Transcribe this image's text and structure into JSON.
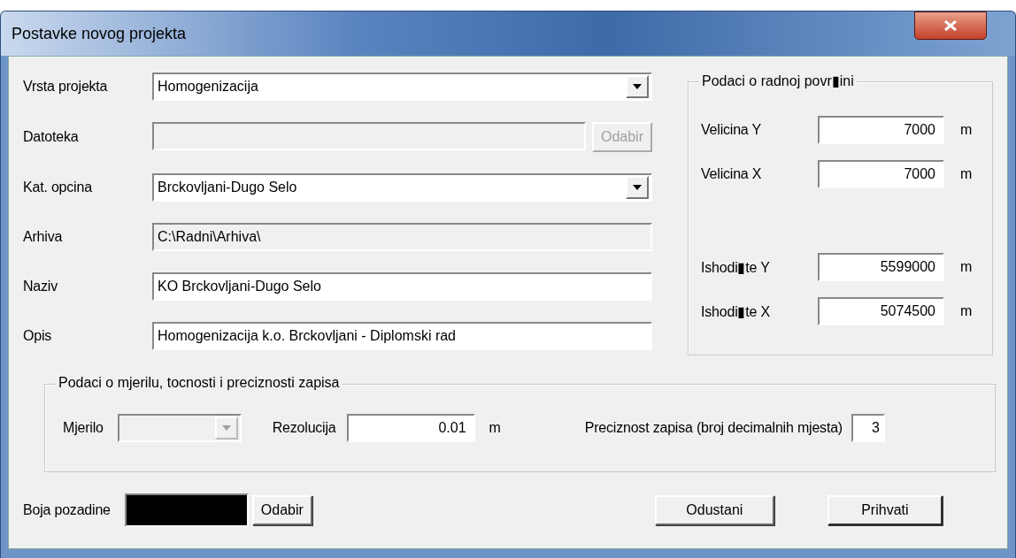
{
  "window": {
    "title": "Postavke novog projekta"
  },
  "fields": [
    {
      "label": "Vrsta projekta",
      "kind": "combo",
      "value": "Homogenizacija",
      "disabled": false
    },
    {
      "label": "Datoteka",
      "kind": "file",
      "button": "Odabir",
      "disabled": true
    },
    {
      "label": "Kat. opcina",
      "kind": "combo",
      "value": "Brckovljani-Dugo Selo",
      "disabled": false
    },
    {
      "label": "Arhiva",
      "kind": "text",
      "value": "C:\\Radni\\Arhiva\\",
      "disabled": true
    },
    {
      "label": "Naziv",
      "kind": "text",
      "value": "KO Brckovljani-Dugo Selo",
      "disabled": false
    },
    {
      "label": "Opis",
      "kind": "text",
      "value": "Homogenizacija k.o. Brckovljani - Diplomski rad",
      "disabled": false
    }
  ],
  "work_area": {
    "title": "Podaci o radnoj povr▮ini",
    "size_fields": [
      {
        "label": "Velicina Y",
        "value": "7000",
        "unit": "m"
      },
      {
        "label": "Velicina X",
        "value": "7000",
        "unit": "m"
      }
    ],
    "origin_fields": [
      {
        "label": "Ishodi▮te Y",
        "value": "5599000",
        "unit": "m"
      },
      {
        "label": "Ishodi▮te X",
        "value": "5074500",
        "unit": "m"
      }
    ]
  },
  "scale_group": {
    "title": "Podaci o mjerilu, tocnosti i preciznosti zapisa",
    "scale_label": "Mjerilo",
    "scale_disabled": true,
    "resolution_label": "Rezolucija",
    "resolution": "0.01",
    "resolution_unit": "m",
    "precision_label": "Preciznost zapisa (broj decimalnih mjesta)",
    "precision": "3"
  },
  "footer": {
    "background_label": "Boja pozadine",
    "color": "#000000",
    "choose_button": "Odabir",
    "cancel_button": "Odustani",
    "accept_button": "Prihvati"
  }
}
